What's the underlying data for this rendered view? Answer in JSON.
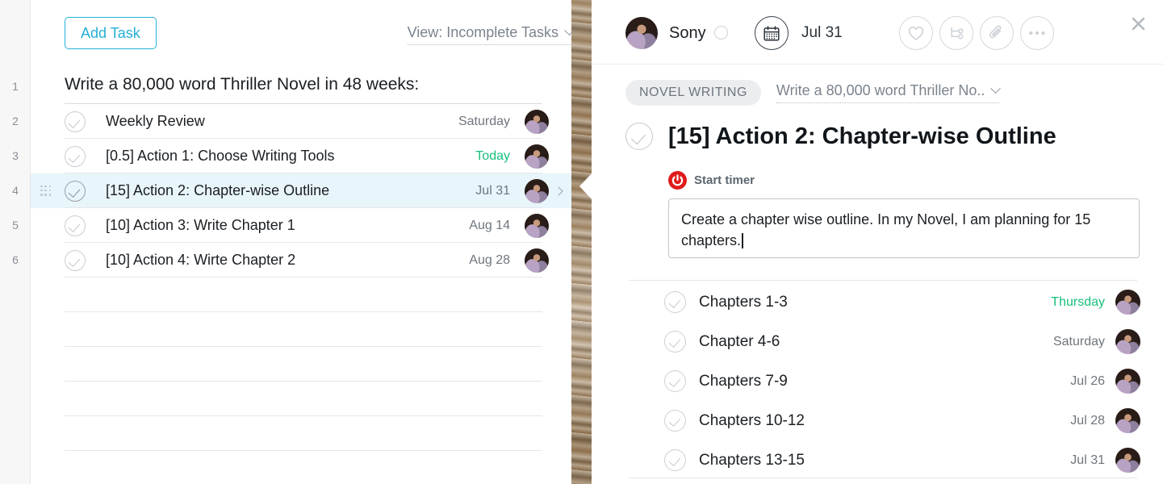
{
  "left_panel": {
    "toolbar": {
      "add_task_label": "Add Task",
      "view_label": "View: Incomplete Tasks"
    },
    "row_numbers": [
      "1",
      "2",
      "3",
      "4",
      "5",
      "6"
    ],
    "list_title": "Write a 80,000 word Thriller Novel in 48 weeks:",
    "tasks": [
      {
        "title": "Weekly Review",
        "date": "Saturday",
        "date_is_today": false,
        "selected": false
      },
      {
        "title": "[0.5] Action 1: Choose Writing Tools",
        "date": "Today",
        "date_is_today": true,
        "selected": false
      },
      {
        "title": "[15] Action 2: Chapter-wise Outline",
        "date": "Jul 31",
        "date_is_today": false,
        "selected": true
      },
      {
        "title": "[10] Action 3: Write Chapter 1",
        "date": "Aug 14",
        "date_is_today": false,
        "selected": false
      },
      {
        "title": "[10] Action 4: Wirte Chapter 2",
        "date": "Aug 28",
        "date_is_today": false,
        "selected": false
      }
    ],
    "empty_rows": 5
  },
  "right_panel": {
    "header": {
      "assignee_name": "Sony",
      "date_label": "Jul 31",
      "calendar_icon": "calendar-icon",
      "status_icon": "status-ring-icon",
      "actions": [
        {
          "icon": "heart-icon",
          "name": "favorite-button"
        },
        {
          "icon": "subtask-icon",
          "name": "subtask-button"
        },
        {
          "icon": "paperclip-icon",
          "name": "attach-button"
        },
        {
          "icon": "ellipsis-icon",
          "name": "more-options-button"
        }
      ],
      "close_icon": "close-icon"
    },
    "breadcrumb": {
      "tag_label": "NOVEL WRITING",
      "project_label": "Write a 80,000 word Thriller No.."
    },
    "task": {
      "title": "[15] Action 2: Chapter-wise Outline",
      "timer_label": "Start timer",
      "timer_icon": "power-icon",
      "notes": "Create a chapter wise outline. In my Novel, I am planning for 15 chapters."
    },
    "subtasks": [
      {
        "title": "Chapters 1-3",
        "date": "Thursday",
        "date_is_soon": true
      },
      {
        "title": "Chapter 4-6",
        "date": "Saturday",
        "date_is_soon": false
      },
      {
        "title": "Chapters 7-9",
        "date": "Jul 26",
        "date_is_soon": false
      },
      {
        "title": "Chapters 10-12",
        "date": "Jul 28",
        "date_is_soon": false
      },
      {
        "title": "Chapters 13-15",
        "date": "Jul 31",
        "date_is_soon": false
      }
    ]
  },
  "colors": {
    "accent_cyan": "#23b0d6",
    "green": "#17c07b",
    "red": "#e01b1b",
    "selected_row": "#e8f5fa"
  }
}
